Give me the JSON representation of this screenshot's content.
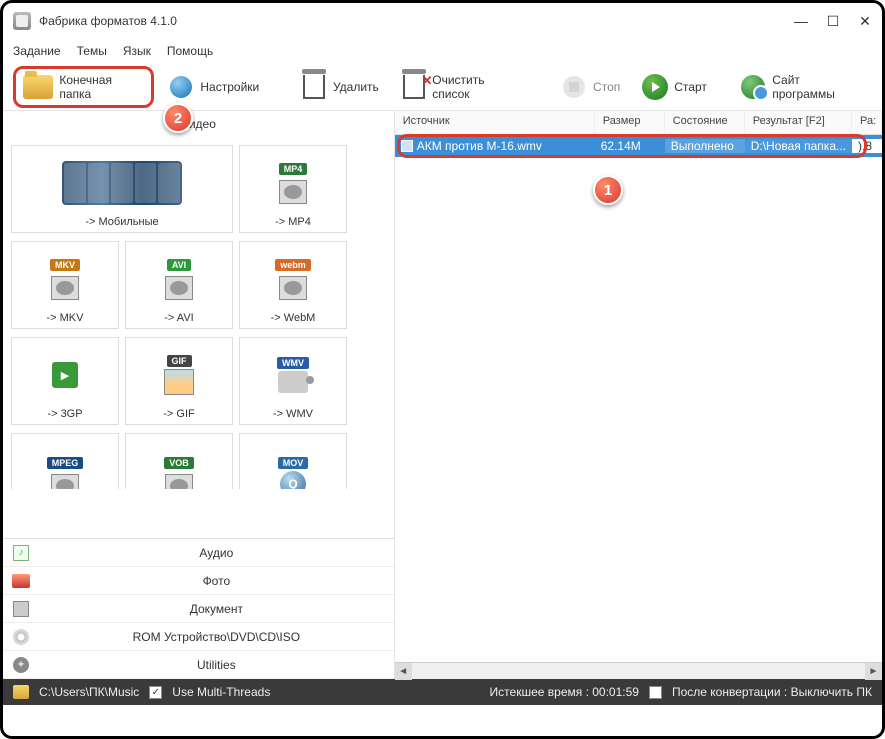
{
  "window": {
    "title": "Фабрика форматов 4.1.0"
  },
  "menu": {
    "task": "Задание",
    "themes": "Темы",
    "lang": "Язык",
    "help": "Помощь"
  },
  "toolbar": {
    "output_folder": "Конечная папка",
    "settings": "Настройки",
    "delete": "Удалить",
    "clear": "Очистить список",
    "stop": "Стоп",
    "start": "Старт",
    "site": "Сайт программы"
  },
  "left": {
    "header": "Видео",
    "formats": {
      "mobile": "-> Мобильные",
      "mp4": "-> MP4",
      "mkv": "-> MKV",
      "avi": "-> AVI",
      "webm": "-> WebM",
      "gp3": "-> 3GP",
      "gif": "-> GIF",
      "wmv": "-> WMV"
    },
    "badges": {
      "mp4": "MP4",
      "mkv": "MKV",
      "avi": "AVI",
      "webm": "webm",
      "gif": "GIF",
      "wmv": "WMV",
      "mpeg": "MPEG",
      "vob": "VOB",
      "mov": "MOV"
    },
    "categories": {
      "audio": "Аудио",
      "photo": "Фото",
      "document": "Документ",
      "rom": "ROM Устройство\\DVD\\CD\\ISO",
      "utilities": "Utilities"
    }
  },
  "list": {
    "columns": {
      "source": "Источник",
      "size": "Размер",
      "state": "Состояние",
      "result": "Результат [F2]",
      "extra": "Ра:"
    },
    "row": {
      "source": "АКМ против М-16.wmv",
      "size": "62.14M",
      "state": "Выполнено",
      "result": "D:\\Новая папка...",
      "extra": ").8"
    }
  },
  "status": {
    "path": "C:\\Users\\ПК\\Music",
    "multithread": "Use Multi-Threads",
    "elapsed": "Истекшее время : 00:01:59",
    "after": "После конвертации : Выключить ПК"
  },
  "callouts": {
    "one": "1",
    "two": "2"
  }
}
